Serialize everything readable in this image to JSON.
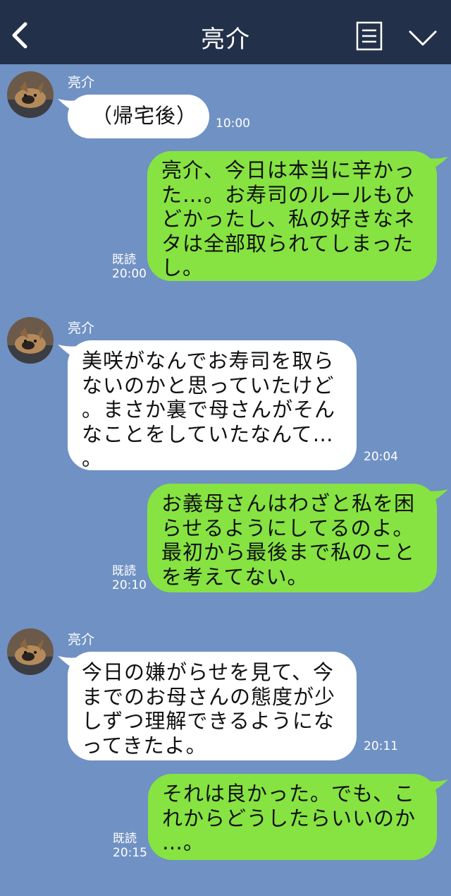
{
  "header": {
    "title": "亮介",
    "back_icon": "chevron-left-icon",
    "menu_icon": "notes-icon",
    "collapse_icon": "chevron-down-icon"
  },
  "colors": {
    "header_bg": "#233049",
    "chat_bg": "#7091c3",
    "incoming_bubble": "#ffffff",
    "outgoing_bubble": "#86e342"
  },
  "messages": [
    {
      "from": "亮介",
      "text": "（帰宅後）",
      "time": "10:00"
    },
    {
      "from": "me",
      "text": "亮介、今日は本当に辛かっ\nた…。お寿司のルールもひ\nどかったし、私の好きなネ\nタは全部取られてしまった\nし。",
      "read": "既読",
      "time": "20:00"
    },
    {
      "from": "亮介",
      "text": "美咲がなんでお寿司を取ら\nないのかと思っていたけど\n。まさか裏で母さんがそん\nなことをしていたなんて…\n。",
      "time": "20:04"
    },
    {
      "from": "me",
      "text": "お義母さんはわざと私を困\nらせるようにしてるのよ。\n最初から最後まで私のこと\nを考えてない。",
      "read": "既読",
      "time": "20:10"
    },
    {
      "from": "亮介",
      "text": "今日の嫌がらせを見て、今\nまでのお母さんの態度が少\nしずつ理解できるようにな\nってきたよ。",
      "time": "20:11"
    },
    {
      "from": "me",
      "text": "それは良かった。でも、こ\nれからどうしたらいいのか\n…。",
      "read": "既読",
      "time": "20:15"
    }
  ]
}
